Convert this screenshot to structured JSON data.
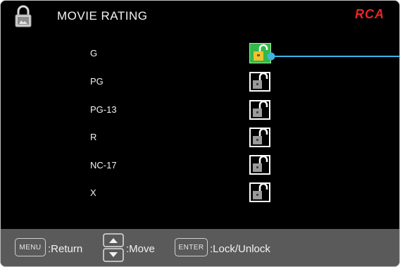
{
  "header": {
    "title": "MOVIE RATING",
    "brand": "RCA",
    "icon": "padlock-icon"
  },
  "ratings": [
    {
      "label": "G",
      "lock_state": "unlocked",
      "selected": true
    },
    {
      "label": "PG",
      "lock_state": "unlocked",
      "selected": false
    },
    {
      "label": "PG-13",
      "lock_state": "unlocked",
      "selected": false
    },
    {
      "label": "R",
      "lock_state": "unlocked",
      "selected": false
    },
    {
      "label": "NC-17",
      "lock_state": "unlocked",
      "selected": false
    },
    {
      "label": "X",
      "lock_state": "unlocked",
      "selected": false
    }
  ],
  "footer": {
    "menu_key": "MENU",
    "menu_action": ":Return",
    "move_action": ":Move",
    "enter_key": "ENTER",
    "enter_action": ":Lock/Unlock"
  },
  "colors": {
    "background": "#000000",
    "footer": "#5a5a5a",
    "brand": "#e5262a",
    "selection": "#3cb4e6",
    "selected_lock": "#33b84a"
  }
}
